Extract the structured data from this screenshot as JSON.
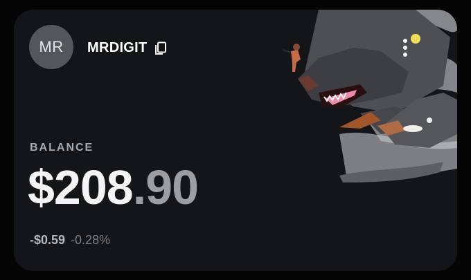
{
  "profile": {
    "avatar_initials": "MR",
    "username": "MRDIGIT"
  },
  "balance": {
    "label": "BALANCE",
    "amount_main": "$208",
    "amount_cents": ".90",
    "change_abs": "-$0.59",
    "change_pct": "-0.28%"
  },
  "icons": {
    "copy": "copy-icon",
    "artwork": "three-headed-wolf-artwork"
  },
  "colors": {
    "card_bg": "#141519",
    "page_bg": "#050506",
    "avatar_bg": "#55565c",
    "primary_text": "#f4f4f6",
    "secondary_text": "#9d9ea4",
    "art_accent_yellow": "#f2e05a",
    "art_tongue_pink": "#e88aa8"
  }
}
